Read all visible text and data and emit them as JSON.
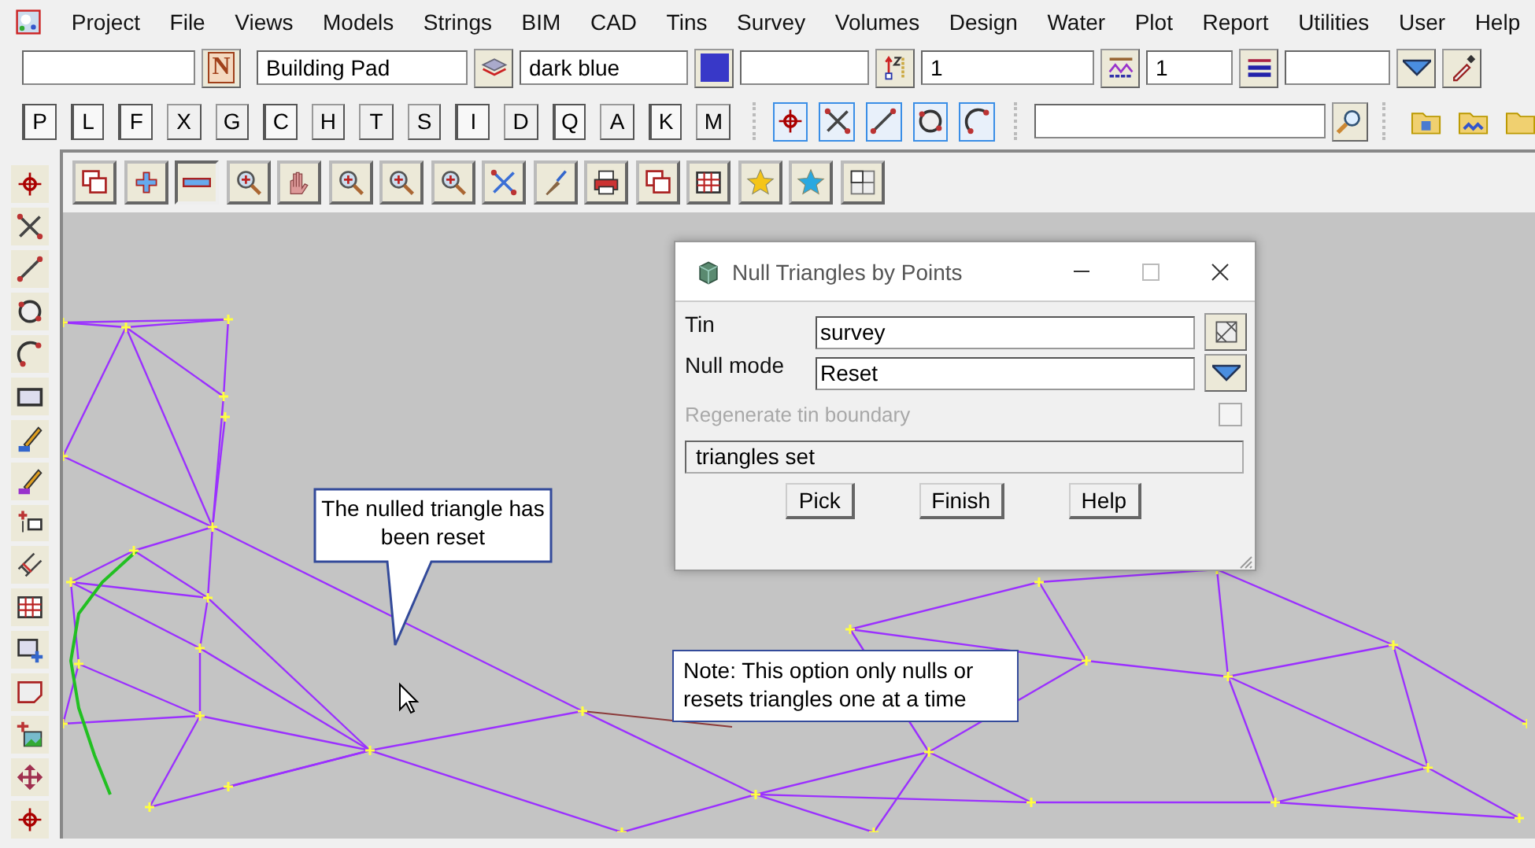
{
  "menu": [
    "Project",
    "File",
    "Views",
    "Models",
    "Strings",
    "BIM",
    "CAD",
    "Tins",
    "Survey",
    "Volumes",
    "Design",
    "Water",
    "Plot",
    "Report",
    "Utilities",
    "User",
    "Help"
  ],
  "attribute_bar": {
    "name_button": "N",
    "model": "Building Pad",
    "colour": "dark blue",
    "linestyle": "1",
    "weight": "1"
  },
  "snap_letters": [
    {
      "label": "P",
      "pressed": true
    },
    {
      "label": "L",
      "pressed": true
    },
    {
      "label": "F",
      "pressed": true
    },
    {
      "label": "X",
      "pressed": false
    },
    {
      "label": "G",
      "pressed": false
    },
    {
      "label": "C",
      "pressed": true
    },
    {
      "label": "H",
      "pressed": false
    },
    {
      "label": "T",
      "pressed": false
    },
    {
      "label": "S",
      "pressed": false
    },
    {
      "label": "I",
      "pressed": true
    },
    {
      "label": "D",
      "pressed": false
    },
    {
      "label": "Q",
      "pressed": true
    },
    {
      "label": "A",
      "pressed": false
    },
    {
      "label": "K",
      "pressed": true
    },
    {
      "label": "M",
      "pressed": false
    }
  ],
  "canvas": {
    "callout": "The nulled triangle has been reset",
    "note": "Note: This option only nulls or resets triangles one at a time"
  },
  "dialog": {
    "title": "Null Triangles by Points",
    "fields": [
      {
        "label": "Tin",
        "value": "survey",
        "kind": "chooser"
      },
      {
        "label": "Null mode",
        "value": "Reset",
        "kind": "dropdown"
      }
    ],
    "regenerate": {
      "label": "Regenerate tin boundary",
      "disabled": true,
      "checked": false
    },
    "status": "triangles set",
    "buttons": [
      "Pick",
      "Finish",
      "Help"
    ]
  }
}
